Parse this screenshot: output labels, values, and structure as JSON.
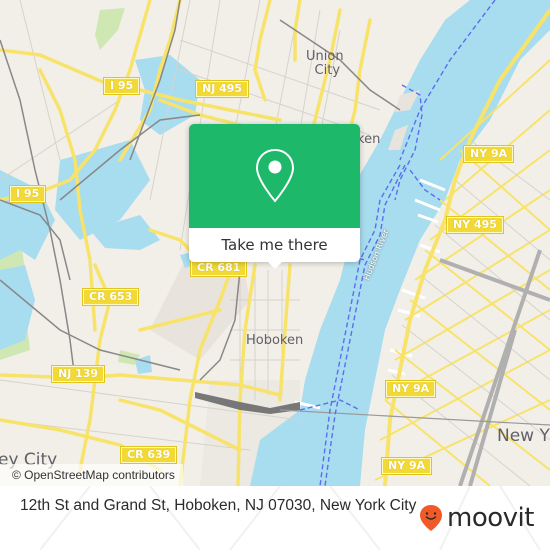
{
  "map": {
    "attribution": "© OpenStreetMap contributors",
    "colors": {
      "land": "#f2efe9",
      "water": "#a8dcef",
      "road_major": "#f8e36a",
      "road_minor": "#d6d3cc",
      "rail": "#777777",
      "park": "#cfe8b3",
      "ferry": "#5b6ef0",
      "shield_bg": "#f2d935"
    },
    "place_labels": [
      {
        "text": "Union",
        "name": "union-city-label"
      },
      {
        "text": "City",
        "name": "union-city-label-2"
      },
      {
        "text": "Hoboken",
        "name": "hoboken-label"
      },
      {
        "text": "New Y",
        "name": "new-york-label"
      },
      {
        "text": "ey City",
        "name": "jersey-city-label"
      },
      {
        "text": "ken",
        "name": "hoboken-north-label"
      }
    ],
    "road_shields": [
      {
        "text": "I 95",
        "name": "shield-i95-north"
      },
      {
        "text": "I 95",
        "name": "shield-i95-west"
      },
      {
        "text": "NJ 495",
        "name": "shield-nj495"
      },
      {
        "text": "NY 9A",
        "name": "shield-ny9a-north"
      },
      {
        "text": "NY 495",
        "name": "shield-ny495"
      },
      {
        "text": "CR 681",
        "name": "shield-cr681"
      },
      {
        "text": "CR 653",
        "name": "shield-cr653"
      },
      {
        "text": "NJ 139",
        "name": "shield-nj139"
      },
      {
        "text": "NY 9A",
        "name": "shield-ny9a-mid"
      },
      {
        "text": "CR 639",
        "name": "shield-cr639"
      },
      {
        "text": "NY 9A",
        "name": "shield-ny9a-south"
      }
    ],
    "river_label": "Hudson River"
  },
  "popup": {
    "icon": "map-pin-icon",
    "button_label": "Take me there",
    "accent": "#1db86a"
  },
  "footer": {
    "address": "12th St and Grand St, Hoboken, NJ 07030, New York City",
    "brand": "moovit",
    "brand_icon": "moovit-smile-pin-icon",
    "brand_color": "#f05a28"
  }
}
